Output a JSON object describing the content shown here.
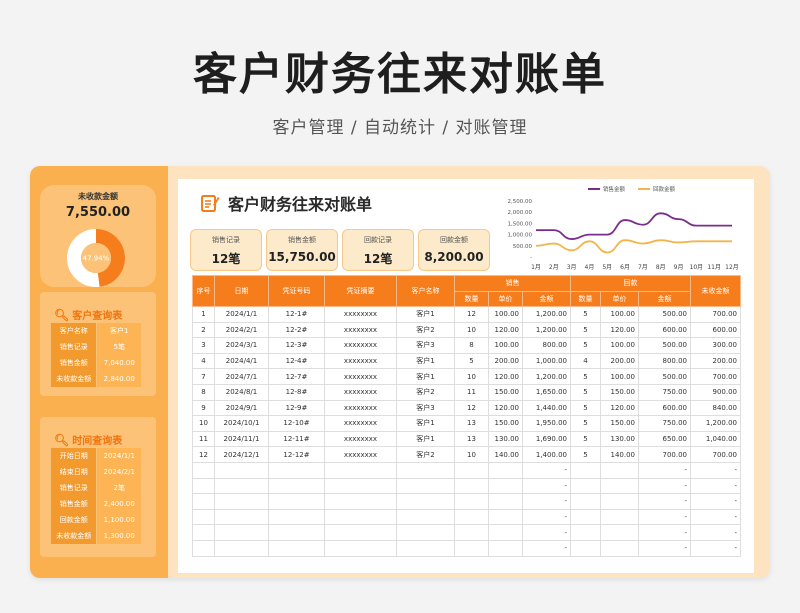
{
  "page": {
    "title": "客户财务往来对账单",
    "subtitle": "客户管理 / 自动统计 / 对账管理"
  },
  "sidebar": {
    "summary": {
      "label": "未收款金额",
      "value": "7,550.00",
      "ratio_text": "47.94%",
      "ratio": 0.4794
    },
    "customer_query": {
      "title": "客户查询表",
      "rows": [
        {
          "k": "客户名称",
          "v": "客户1"
        },
        {
          "k": "销售记录",
          "v": "5笔"
        },
        {
          "k": "销售金额",
          "v": "7,040.00"
        },
        {
          "k": "未收款金额",
          "v": "2,840.00"
        }
      ]
    },
    "time_query": {
      "title": "时间查询表",
      "rows": [
        {
          "k": "开始日期",
          "v": "2024/1/1"
        },
        {
          "k": "结束日期",
          "v": "2024/2/1"
        },
        {
          "k": "销售记录",
          "v": "2笔"
        },
        {
          "k": "销售金额",
          "v": "2,400.00"
        },
        {
          "k": "回款金额",
          "v": "1,100.00"
        },
        {
          "k": "未收款金额",
          "v": "1,300.00"
        }
      ]
    }
  },
  "main": {
    "title": "客户财务往来对账单",
    "stats": [
      {
        "label": "销售记录",
        "value": "12笔"
      },
      {
        "label": "销售金额",
        "value": "15,750.00"
      },
      {
        "label": "回款记录",
        "value": "12笔"
      },
      {
        "label": "回款金额",
        "value": "8,200.00"
      }
    ]
  },
  "colors": {
    "accent": "#f57d1c",
    "sales_line": "#7b2d8e",
    "payment_line": "#f3b54a"
  },
  "chart_data": {
    "type": "line",
    "categories": [
      "1月",
      "2月",
      "3月",
      "4月",
      "5月",
      "6月",
      "7月",
      "8月",
      "9月",
      "10月",
      "11月",
      "12月"
    ],
    "series": [
      {
        "name": "销售金额",
        "values": [
          1200,
          1200,
          800,
          1000,
          1000,
          1650,
          1440,
          1950,
          1690,
          1400,
          1400,
          1400
        ]
      },
      {
        "name": "回款金额",
        "values": [
          500,
          600,
          300,
          700,
          200,
          750,
          600,
          750,
          650,
          700,
          700,
          700
        ]
      }
    ],
    "yticks": [
      "2,500.00",
      "2,000.00",
      "1,500.00",
      "1,000.00",
      "500.00",
      "-"
    ],
    "ylim": [
      0,
      2500
    ],
    "legend": "top"
  },
  "table": {
    "headers_top": [
      "序号",
      "日期",
      "凭证号码",
      "凭证摘要",
      "客户名称",
      "销售",
      "回款",
      "未收金额"
    ],
    "headers_sub": [
      "数量",
      "单价",
      "金额",
      "数量",
      "单价",
      "金额"
    ],
    "rows": [
      [
        "1",
        "2024/1/1",
        "12-1#",
        "xxxxxxxx",
        "客户1",
        "12",
        "100.00",
        "1,200.00",
        "5",
        "100.00",
        "500.00",
        "700.00"
      ],
      [
        "2",
        "2024/2/1",
        "12-2#",
        "xxxxxxxx",
        "客户2",
        "10",
        "120.00",
        "1,200.00",
        "5",
        "120.00",
        "600.00",
        "600.00"
      ],
      [
        "3",
        "2024/3/1",
        "12-3#",
        "xxxxxxxx",
        "客户3",
        "8",
        "100.00",
        "800.00",
        "5",
        "100.00",
        "500.00",
        "300.00"
      ],
      [
        "4",
        "2024/4/1",
        "12-4#",
        "xxxxxxxx",
        "客户1",
        "5",
        "200.00",
        "1,000.00",
        "4",
        "200.00",
        "800.00",
        "200.00"
      ],
      [
        "7",
        "2024/7/1",
        "12-7#",
        "xxxxxxxx",
        "客户1",
        "10",
        "120.00",
        "1,200.00",
        "5",
        "100.00",
        "500.00",
        "700.00"
      ],
      [
        "8",
        "2024/8/1",
        "12-8#",
        "xxxxxxxx",
        "客户2",
        "11",
        "150.00",
        "1,650.00",
        "5",
        "150.00",
        "750.00",
        "900.00"
      ],
      [
        "9",
        "2024/9/1",
        "12-9#",
        "xxxxxxxx",
        "客户3",
        "12",
        "120.00",
        "1,440.00",
        "5",
        "120.00",
        "600.00",
        "840.00"
      ],
      [
        "10",
        "2024/10/1",
        "12-10#",
        "xxxxxxxx",
        "客户1",
        "13",
        "150.00",
        "1,950.00",
        "5",
        "150.00",
        "750.00",
        "1,200.00"
      ],
      [
        "11",
        "2024/11/1",
        "12-11#",
        "xxxxxxxx",
        "客户1",
        "13",
        "130.00",
        "1,690.00",
        "5",
        "130.00",
        "650.00",
        "1,040.00"
      ],
      [
        "12",
        "2024/12/1",
        "12-12#",
        "xxxxxxxx",
        "客户2",
        "10",
        "140.00",
        "1,400.00",
        "5",
        "140.00",
        "700.00",
        "700.00"
      ],
      [
        "",
        "",
        "",
        "",
        "",
        "",
        "",
        "-",
        "",
        "",
        "-",
        "-"
      ],
      [
        "",
        "",
        "",
        "",
        "",
        "",
        "",
        "-",
        "",
        "",
        "-",
        "-"
      ],
      [
        "",
        "",
        "",
        "",
        "",
        "",
        "",
        "-",
        "",
        "",
        "-",
        "-"
      ],
      [
        "",
        "",
        "",
        "",
        "",
        "",
        "",
        "-",
        "",
        "",
        "-",
        "-"
      ],
      [
        "",
        "",
        "",
        "",
        "",
        "",
        "",
        "-",
        "",
        "",
        "-",
        "-"
      ],
      [
        "",
        "",
        "",
        "",
        "",
        "",
        "",
        "-",
        "",
        "",
        "-",
        "-"
      ]
    ]
  }
}
